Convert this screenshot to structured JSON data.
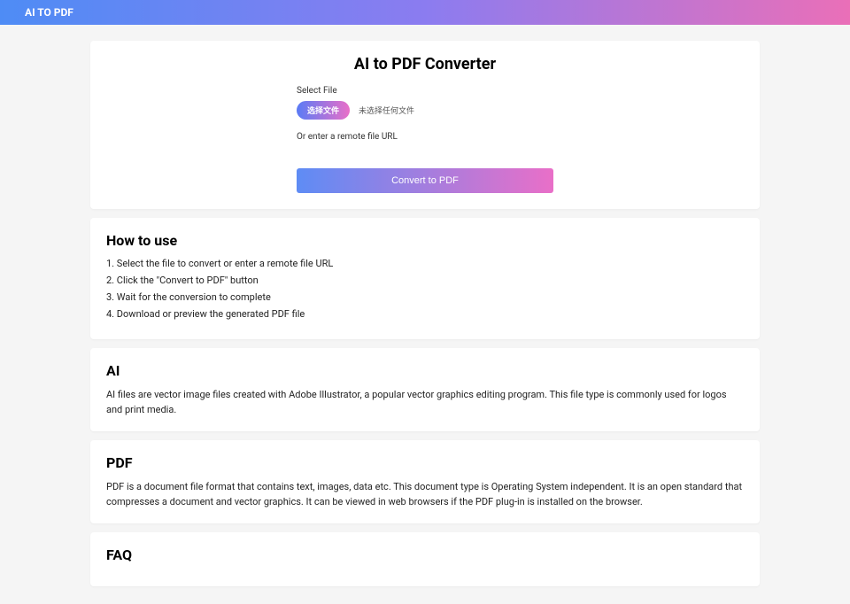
{
  "header": {
    "title": "AI TO PDF"
  },
  "converter": {
    "title": "AI to PDF Converter",
    "select_file_label": "Select File",
    "choose_button": "选择文件",
    "file_status": "未选择任何文件",
    "or_label": "Or enter a remote file URL",
    "convert_button": "Convert to PDF"
  },
  "howto": {
    "title": "How to use",
    "steps": [
      "1. Select the file to convert or enter a remote file URL",
      "2. Click the \"Convert to PDF\" button",
      "3. Wait for the conversion to complete",
      "4. Download or preview the generated PDF file"
    ]
  },
  "ai_section": {
    "title": "AI",
    "text": "AI files are vector image files created with Adobe Illustrator, a popular vector graphics editing program. This file type is commonly used for logos and print media."
  },
  "pdf_section": {
    "title": "PDF",
    "text": "PDF is a document file format that contains text, images, data etc. This document type is Operating System independent. It is an open standard that compresses a document and vector graphics. It can be viewed in web browsers if the PDF plug-in is installed on the browser."
  },
  "faq_section": {
    "title": "FAQ"
  }
}
